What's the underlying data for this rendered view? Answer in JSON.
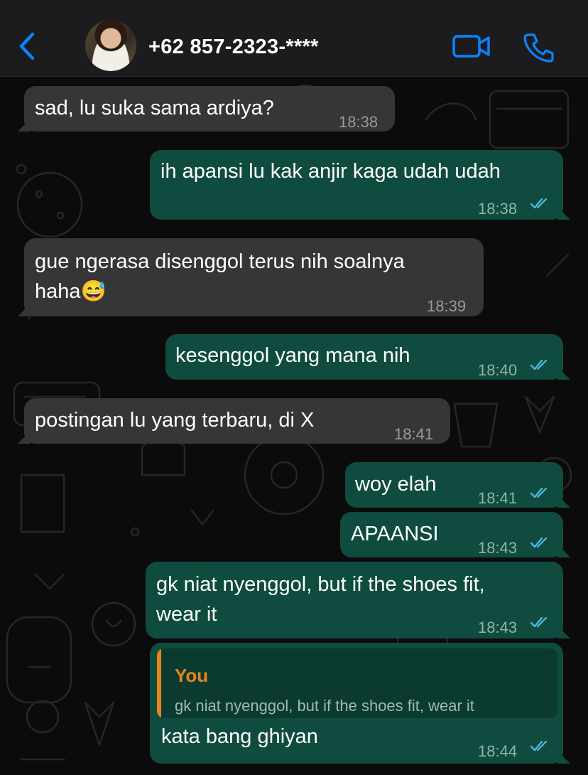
{
  "header": {
    "contact_name": "+62 857-2323-****"
  },
  "messages": [
    {
      "direction": "incoming",
      "text": "sad, lu suka sama ardiya?",
      "time": "18:38"
    },
    {
      "direction": "outgoing",
      "text": "ih apansi lu kak anjir kaga udah udah",
      "time": "18:38",
      "status": "read"
    },
    {
      "direction": "incoming",
      "lines": [
        "gue ngerasa disenggol terus nih soalnya",
        "haha😅"
      ],
      "time": "18:39"
    },
    {
      "direction": "outgoing",
      "text": "kesenggol yang mana nih",
      "time": "18:40",
      "status": "read"
    },
    {
      "direction": "incoming",
      "text": "postingan lu yang terbaru, di X",
      "time": "18:41"
    },
    {
      "direction": "outgoing",
      "text": "woy elah",
      "time": "18:41",
      "status": "read"
    },
    {
      "direction": "outgoing",
      "text": "APAANSI",
      "time": "18:43",
      "status": "read"
    },
    {
      "direction": "outgoing",
      "lines": [
        "gk niat nyenggol, but if the shoes fit,",
        "wear it"
      ],
      "time": "18:43",
      "status": "read"
    },
    {
      "direction": "outgoing",
      "reply": {
        "author": "You",
        "text": "gk niat nyenggol, but if the shoes fit, wear it"
      },
      "text": "kata bang ghiyan",
      "time": "18:44",
      "status": "read"
    }
  ],
  "icons": {
    "back": "chevron-left-icon",
    "video": "video-camera-icon",
    "call": "phone-icon",
    "read_receipt": "double-check-icon"
  },
  "colors": {
    "accent": "#0a84ff",
    "incoming_bubble": "#363638",
    "outgoing_bubble": "#0f4c3f",
    "reply_author": "#e9841c",
    "read_ticks": "#53bdeb"
  }
}
